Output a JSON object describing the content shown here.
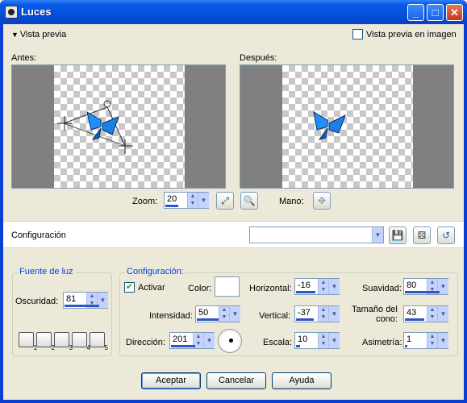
{
  "window": {
    "title": "Luces",
    "minimize_icon": "minimize-icon",
    "maximize_icon": "maximize-icon",
    "close_icon": "close-icon"
  },
  "preview": {
    "toggle_label": "Vista previa",
    "in_image_label": "Vista previa en imagen",
    "in_image_checked": false,
    "before_label": "Antes:",
    "after_label": "Después:",
    "zoom_label": "Zoom:",
    "zoom_value": "20",
    "pan_label": "Mano:"
  },
  "config_bar": {
    "label": "Configuración",
    "preset_value": ""
  },
  "light_source": {
    "title": "Fuente de luz",
    "darkness_label": "Oscuridad:",
    "darkness_value": "81",
    "preset_numbers": [
      "1",
      "2",
      "3",
      "4",
      "5"
    ]
  },
  "settings": {
    "title": "Configuración:",
    "activate_label": "Activar",
    "activate_checked": true,
    "color_label": "Color:",
    "color_value": "#ffffff",
    "intensity_label": "Intensidad:",
    "intensity_value": "50",
    "direction_label": "Dirección:",
    "direction_value": "201",
    "horizontal_label": "Horizontal:",
    "horizontal_value": "-16",
    "vertical_label": "Vertical:",
    "vertical_value": "-37",
    "scale_label": "Escala:",
    "scale_value": "10",
    "softness_label": "Suavidad:",
    "softness_value": "80",
    "cone_label_1": "Tamaño del",
    "cone_label_2": "cono:",
    "cone_value": "43",
    "asymmetry_label": "Asimetría:",
    "asymmetry_value": "1"
  },
  "buttons": {
    "ok": "Aceptar",
    "cancel": "Cancelar",
    "help": "Ayuda"
  },
  "colors": {
    "title_bar": "#0551de",
    "dialog_bg": "#ece9d8",
    "group_title": "#0046d5",
    "butterfly": "#1e90ff"
  }
}
